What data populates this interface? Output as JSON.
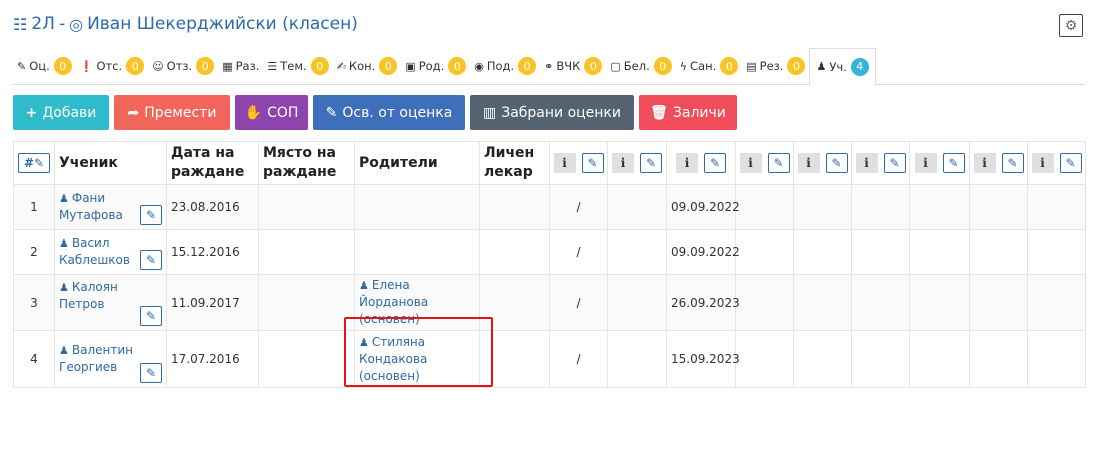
{
  "page": {
    "title": "2Л - Иван Шекерджийски (класен)",
    "title_class": "2Л",
    "title_sep": "-",
    "title_teacher": "Иван Шекерджийски (класен)"
  },
  "tabs": [
    {
      "label": "Оц.",
      "badge": "0",
      "icon": "pencil-icon"
    },
    {
      "label": "Отс.",
      "badge": "0",
      "icon": "exclamation-icon"
    },
    {
      "label": "Отз.",
      "badge": "0",
      "icon": "users-icon"
    },
    {
      "label": "Раз.",
      "badge": "",
      "icon": "table-icon"
    },
    {
      "label": "Тем.",
      "badge": "0",
      "icon": "list-icon"
    },
    {
      "label": "Кон.",
      "badge": "0",
      "icon": "edit-icon"
    },
    {
      "label": "Род.",
      "badge": "0",
      "icon": "calendar-icon"
    },
    {
      "label": "Под.",
      "badge": "0",
      "icon": "eye-icon"
    },
    {
      "label": "ВЧК",
      "badge": "0",
      "icon": "handshake-icon"
    },
    {
      "label": "Бел.",
      "badge": "0",
      "icon": "note-icon"
    },
    {
      "label": "Сан.",
      "badge": "0",
      "icon": "bolt-icon"
    },
    {
      "label": "Рез.",
      "badge": "0",
      "icon": "doc-icon"
    },
    {
      "label": "Уч.",
      "badge": "4",
      "icon": "student-icon",
      "active": true
    }
  ],
  "actions": [
    {
      "label": "Добави",
      "icon": "+",
      "color": "#2fbbc9"
    },
    {
      "label": "Премести",
      "icon": "➦",
      "color": "#f1655a"
    },
    {
      "label": "СОП",
      "icon": "✋",
      "color": "#8e44ad"
    },
    {
      "label": "Осв. от оценка",
      "icon": "✎",
      "color": "#3e6fbb"
    },
    {
      "label": "Забрани оценки",
      "icon": "▥",
      "color": "#556371"
    },
    {
      "label": "Заличи",
      "icon": "🗑",
      "color": "#ef4d59"
    }
  ],
  "table": {
    "headers": {
      "num": "#",
      "student": "Ученик",
      "dob": "Дата на раждане",
      "pob": "Място на раждане",
      "parents": "Родители",
      "doctor": "Личен лекар"
    },
    "info_glyph": "i",
    "rows": [
      {
        "num": "1",
        "student": "Фани Мутафова",
        "dob": "23.08.2016",
        "pob": "",
        "parents": "",
        "doctor": "",
        "slash": "/",
        "date": "09.09.2022"
      },
      {
        "num": "2",
        "student": "Васил Каблешков",
        "dob": "15.12.2016",
        "pob": "",
        "parents": "",
        "doctor": "",
        "slash": "/",
        "date": "09.09.2022"
      },
      {
        "num": "3",
        "student": "Калоян Петров",
        "dob": "11.09.2017",
        "pob": "",
        "parents": "Елена Йорданова (основен)",
        "doctor": "",
        "slash": "/",
        "date": "26.09.2023"
      },
      {
        "num": "4",
        "student": "Валентин Георгиев",
        "dob": "17.07.2016",
        "pob": "",
        "parents": "Стиляна Кондакова (основен)",
        "doctor": "",
        "slash": "/",
        "date": "15.09.2023"
      }
    ]
  }
}
